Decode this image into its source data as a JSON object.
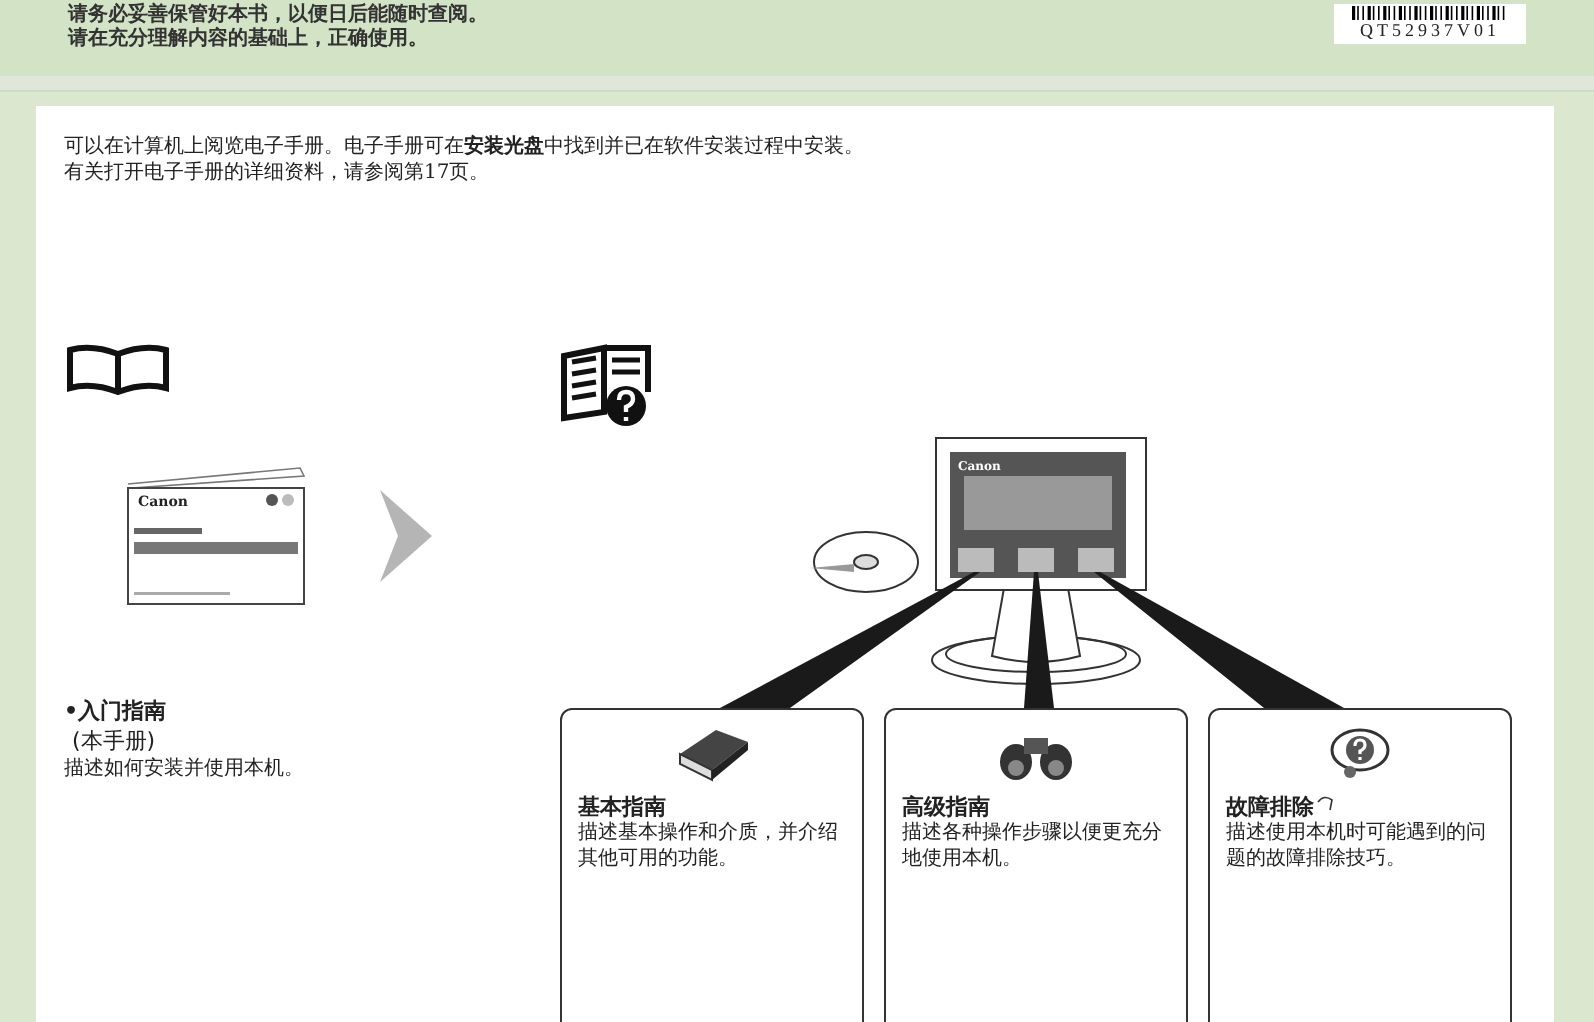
{
  "header": {
    "lines": [
      "请务必妥善保管好本书，以便日后能随时查阅。",
      "请在充分理解内容的基础上，正确使用。"
    ],
    "code": "QT52937V01"
  },
  "intro": [
    "可以在计算机上阅览电子手册。电子手册可在**安装光盘**中找到并已在软件安装过程中安装。",
    "有关打开电子手册的详细资料，请参阅第17页。"
  ],
  "printed_manual": {
    "cover_brand": "Canon",
    "title": "•入门指南",
    "subtitle": "(本手册)",
    "description": "描述如何安装并使用本机。"
  },
  "device": {
    "brand": "Canon"
  },
  "guides": [
    {
      "kind": "book",
      "title": "基本指南",
      "description": "描述基本操作和介质，并介绍其他可用的功能。"
    },
    {
      "kind": "binoculars",
      "title": "高级指南",
      "description": "描述各种操作步骤以便更充分地使用本机。"
    },
    {
      "kind": "help",
      "title": "故障排除",
      "description": "描述使用本机时可能遇到的问题的故障排除技巧。"
    }
  ]
}
